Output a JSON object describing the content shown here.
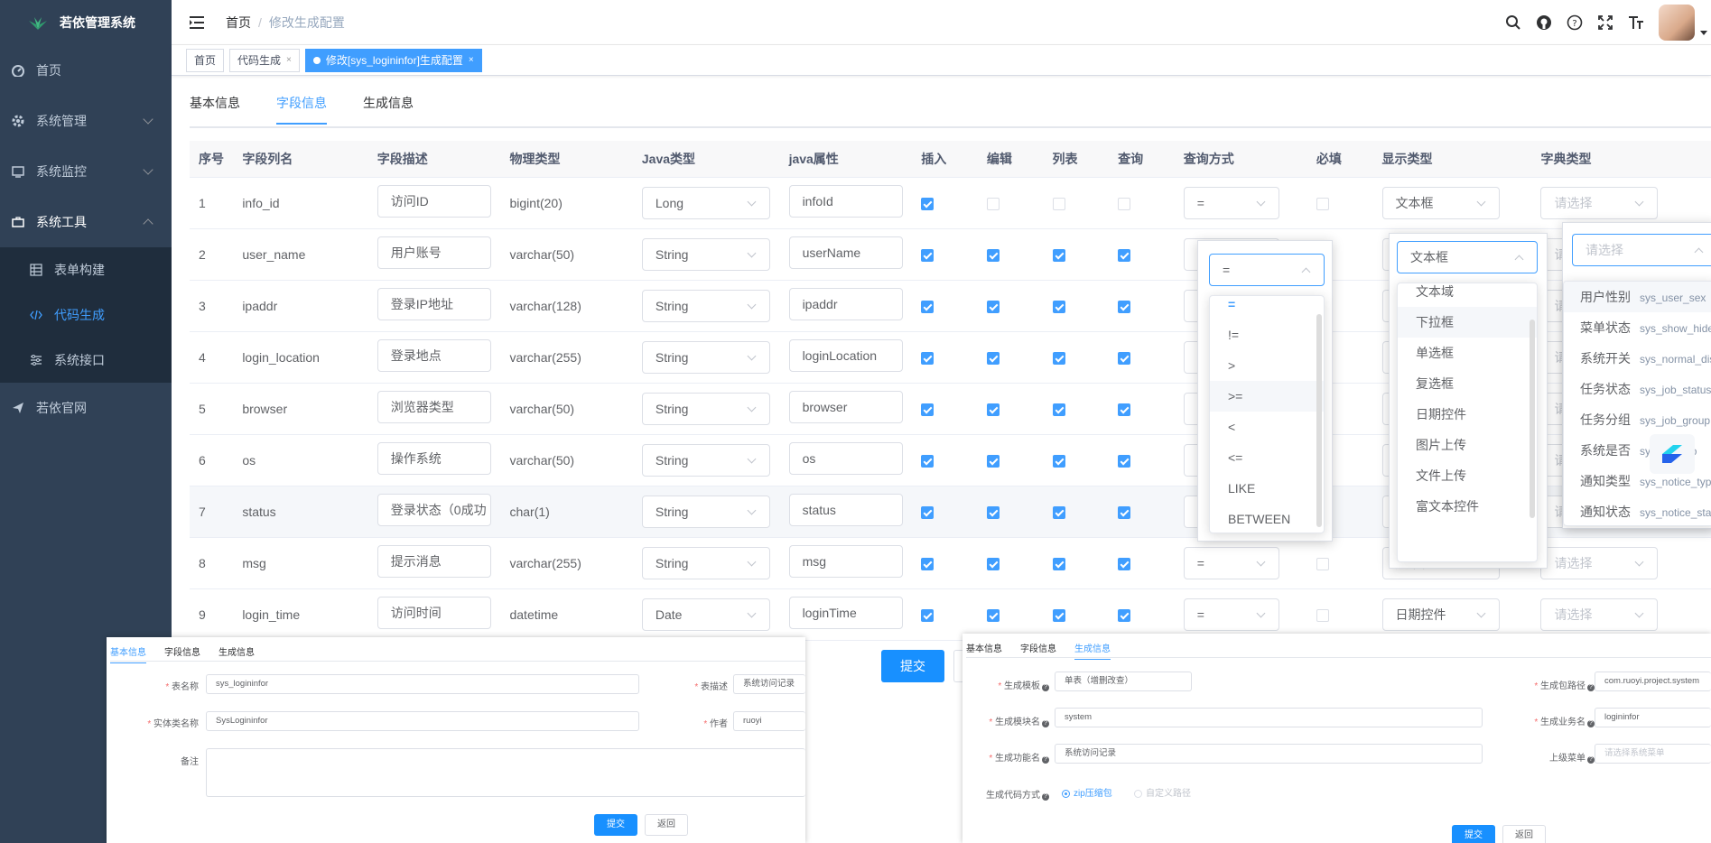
{
  "app": {
    "title": "若依管理系统"
  },
  "sidebar": {
    "items": [
      {
        "label": "首页",
        "icon": "dashboard-icon"
      },
      {
        "label": "系统管理",
        "icon": "gear-icon"
      },
      {
        "label": "系统监控",
        "icon": "monitor-icon"
      },
      {
        "label": "系统工具",
        "icon": "toolbox-icon"
      }
    ],
    "sub_items": [
      {
        "label": "表单构建",
        "icon": "form-icon"
      },
      {
        "label": "代码生成",
        "icon": "code-icon"
      },
      {
        "label": "系统接口",
        "icon": "api-icon"
      }
    ],
    "last_item": {
      "label": "若依官网",
      "icon": "send-icon"
    }
  },
  "header": {
    "breadcrumb": [
      "首页",
      "/",
      "修改生成配置"
    ]
  },
  "tags": [
    "首页",
    "代码生成",
    "修改[sys_logininfor]生成配置"
  ],
  "tabs": [
    "基本信息",
    "字段信息",
    "生成信息"
  ],
  "table": {
    "headers": [
      "序号",
      "字段列名",
      "字段描述",
      "物理类型",
      "Java类型",
      "java属性",
      "插入",
      "编辑",
      "列表",
      "查询",
      "查询方式",
      "必填",
      "显示类型",
      "字典类型"
    ],
    "rows": [
      {
        "no": "1",
        "col": "info_id",
        "desc": "访问ID",
        "ptype": "bigint(20)",
        "jtype": "Long",
        "jattr": "infoId",
        "query": "=",
        "show": "文本框",
        "dict": "请选择"
      },
      {
        "no": "2",
        "col": "user_name",
        "desc": "用户账号",
        "ptype": "varchar(50)",
        "jtype": "String",
        "jattr": "userName",
        "query": "=",
        "show": "文本框",
        "dict": "请选择"
      },
      {
        "no": "3",
        "col": "ipaddr",
        "desc": "登录IP地址",
        "ptype": "varchar(128)",
        "jtype": "String",
        "jattr": "ipaddr",
        "query": "=",
        "show": "文本框",
        "dict": "请选择"
      },
      {
        "no": "4",
        "col": "login_location",
        "desc": "登录地点",
        "ptype": "varchar(255)",
        "jtype": "String",
        "jattr": "loginLocation",
        "query": "=",
        "show": "文本框",
        "dict": "请选择"
      },
      {
        "no": "5",
        "col": "browser",
        "desc": "浏览器类型",
        "ptype": "varchar(50)",
        "jtype": "String",
        "jattr": "browser",
        "query": "=",
        "show": "文本框",
        "dict": "请选择"
      },
      {
        "no": "6",
        "col": "os",
        "desc": "操作系统",
        "ptype": "varchar(50)",
        "jtype": "String",
        "jattr": "os",
        "query": "=",
        "show": "文本框",
        "dict": "请选择"
      },
      {
        "no": "7",
        "col": "status",
        "desc": "登录状态（0成功",
        "ptype": "char(1)",
        "jtype": "String",
        "jattr": "status",
        "query": "=",
        "show": "文本框",
        "dict": "请选择"
      },
      {
        "no": "8",
        "col": "msg",
        "desc": "提示消息",
        "ptype": "varchar(255)",
        "jtype": "String",
        "jattr": "msg",
        "query": "=",
        "show": "文本框",
        "dict": "请选择"
      },
      {
        "no": "9",
        "col": "login_time",
        "desc": "访问时间",
        "ptype": "datetime",
        "jtype": "Date",
        "jattr": "loginTime",
        "query": "=",
        "show": "日期控件",
        "dict": "请选择"
      }
    ],
    "checks": [
      [
        true,
        false,
        false,
        false,
        false
      ],
      [
        true,
        true,
        true,
        true,
        false
      ],
      [
        true,
        true,
        true,
        true,
        false
      ],
      [
        true,
        true,
        true,
        true,
        false
      ],
      [
        true,
        true,
        true,
        true,
        false
      ],
      [
        true,
        true,
        true,
        true,
        false
      ],
      [
        true,
        true,
        true,
        true,
        false
      ],
      [
        true,
        true,
        true,
        true,
        false
      ],
      [
        true,
        true,
        true,
        true,
        false
      ]
    ]
  },
  "query_dropdown": {
    "value": "=",
    "options": [
      "=",
      "!=",
      ">",
      ">=",
      "<",
      "<=",
      "LIKE",
      "BETWEEN"
    ]
  },
  "show_dropdown": {
    "value": "文本框",
    "options": [
      "文本域",
      "下拉框",
      "单选框",
      "复选框",
      "日期控件",
      "图片上传",
      "文件上传",
      "富文本控件"
    ]
  },
  "dict_dropdown": {
    "placeholder": "请选择",
    "options": [
      {
        "name": "用户性别",
        "code": "sys_user_sex"
      },
      {
        "name": "菜单状态",
        "code": "sys_show_hide"
      },
      {
        "name": "系统开关",
        "code": "sys_normal_disable"
      },
      {
        "name": "任务状态",
        "code": "sys_job_status"
      },
      {
        "name": "任务分组",
        "code": "sys_job_group"
      },
      {
        "name": "系统是否",
        "code": "sys_yes_no"
      },
      {
        "name": "通知类型",
        "code": "sys_notice_type"
      },
      {
        "name": "通知状态",
        "code": "sys_notice_status"
      }
    ]
  },
  "buttons": {
    "submit": "提交",
    "back": "返回"
  },
  "basic_panel": {
    "tabs": [
      "基本信息",
      "字段信息",
      "生成信息"
    ],
    "table_name_label": "表名称",
    "table_name": "sys_logininfor",
    "table_desc_label": "表描述",
    "table_desc": "系统访问记录",
    "class_name_label": "实体类名称",
    "class_name": "SysLogininfor",
    "author_label": "作者",
    "author": "ruoyi",
    "remark_label": "备注",
    "submit": "提交",
    "back": "返回"
  },
  "gen_panel": {
    "tabs": [
      "基本信息",
      "字段信息",
      "生成信息"
    ],
    "template_label": "生成模板",
    "template": "单表（增删改查）",
    "package_label": "生成包路径",
    "package": "com.ruoyi.project.system",
    "module_label": "生成模块名",
    "module": "system",
    "business_label": "生成业务名",
    "business": "logininfor",
    "function_label": "生成功能名",
    "function": "系统访问记录",
    "parent_menu_label": "上级菜单",
    "parent_menu_placeholder": "请选择系统菜单",
    "gen_type_label": "生成代码方式",
    "gen_type_zip": "zip压缩包",
    "gen_type_custom": "自定义路径",
    "submit": "提交",
    "back": "返回"
  },
  "colors": {
    "sidebar": "#304156",
    "submenu": "#1f2d3d",
    "primary": "#409eff",
    "button": "#1890ff"
  }
}
